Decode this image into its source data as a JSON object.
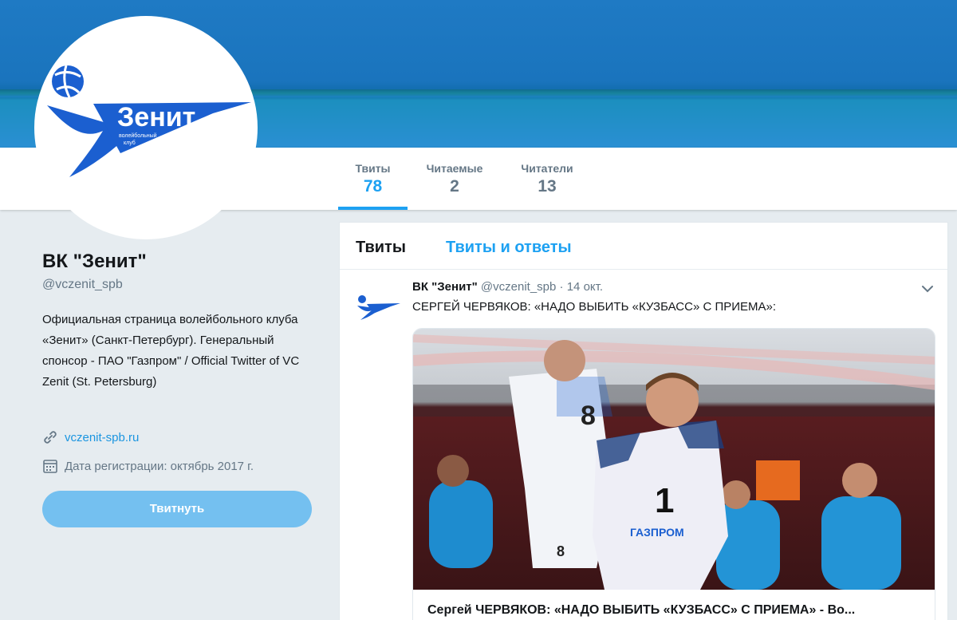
{
  "profile": {
    "name": "ВК \"Зенит\"",
    "handle": "@vczenit_spb",
    "bio": "Официальная страница волейбольного клуба «Зенит» (Санкт-Петербург). Генеральный спонсор - ПАО \"Газпром\" / Official Twitter of VC Zenit (St. Petersburg)",
    "website": "vczenit-spb.ru",
    "joined": "Дата регистрации: октябрь 2017 г.",
    "tweet_button": "Твитнуть",
    "logo": {
      "word": "Зенит",
      "sub1": "волейбольный",
      "sub2": "клуб"
    }
  },
  "stats": [
    {
      "label": "Твиты",
      "value": "78",
      "active": true
    },
    {
      "label": "Читаемые",
      "value": "2",
      "active": false
    },
    {
      "label": "Читатели",
      "value": "13",
      "active": false
    }
  ],
  "timeline": {
    "tabs": [
      "Твиты",
      "Твиты и ответы"
    ]
  },
  "tweet": {
    "name": "ВК \"Зенит\"",
    "handle": "@vczenit_spb",
    "dot": "·",
    "date": "14 окт.",
    "text": "СЕРГЕЙ ЧЕРВЯКОВ: «НАДО ВЫБИТЬ «КУЗБАСС» С ПРИЕМА»:",
    "card_title": "Сергей ЧЕРВЯКОВ: «НАДО ВЫБИТЬ «КУЗБАСС» С ПРИЕМА» - Во...",
    "jersey_numbers": [
      "8",
      "1"
    ],
    "sponsor": "ГАЗПРОМ"
  },
  "colors": {
    "accent": "#1da1f2",
    "banner": "#1f7ac4",
    "logo_blue": "#1b5fd0",
    "button": "#74c0f0"
  },
  "icons": [
    "link-icon",
    "calendar-icon",
    "chevron-down-icon",
    "volleyball-icon"
  ]
}
